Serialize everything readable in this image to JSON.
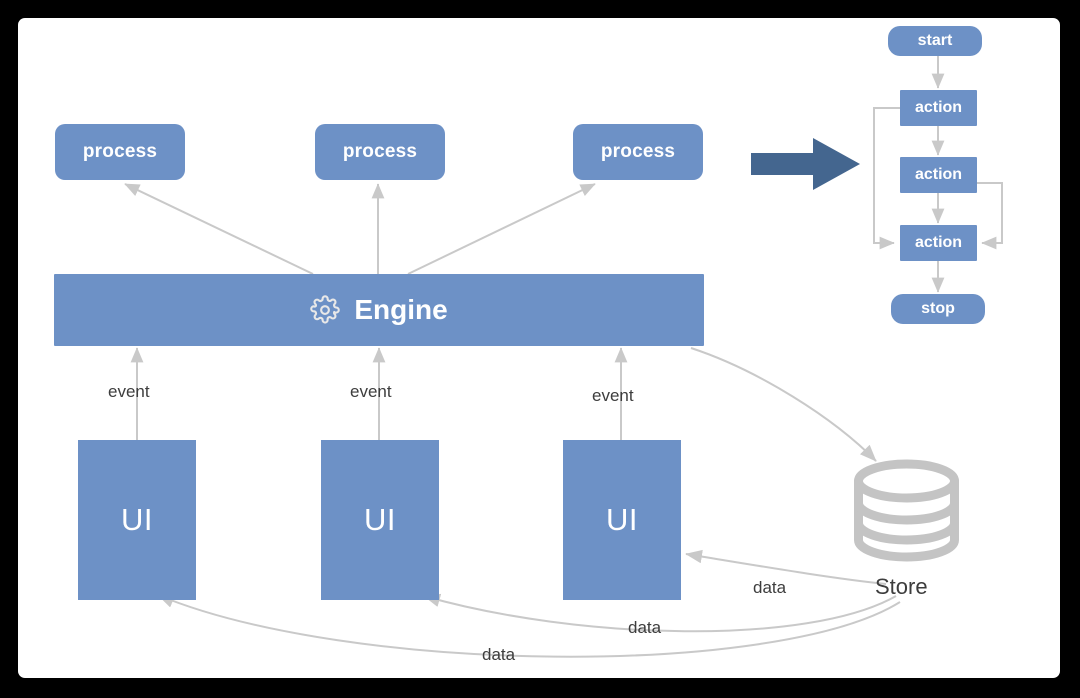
{
  "diagram": {
    "title": "Engine / UI / Store architecture diagram",
    "colors": {
      "node_blue": "#6d91c6",
      "arrow_dark_blue": "#44668f",
      "connector_gray": "#c9c9c9",
      "store_gray": "#c4c4c4",
      "label_text": "#3d3d3d",
      "canvas_background": "#ffffff",
      "frame_background": "#000000"
    },
    "processes": [
      {
        "label": "process"
      },
      {
        "label": "process"
      },
      {
        "label": "process"
      }
    ],
    "engine": {
      "label": "Engine",
      "icon": "gear-icon"
    },
    "uis": [
      {
        "label": "UI",
        "event_label": "event"
      },
      {
        "label": "UI",
        "event_label": "event"
      },
      {
        "label": "UI",
        "event_label": "event"
      }
    ],
    "store": {
      "label": "Store",
      "icon": "database-cylinder-icon"
    },
    "data_labels": [
      {
        "label": "data"
      },
      {
        "label": "data"
      },
      {
        "label": "data"
      }
    ],
    "big_arrow": {
      "icon": "right-arrow-icon"
    },
    "flowchart": {
      "start": {
        "label": "start"
      },
      "actions": [
        {
          "label": "action"
        },
        {
          "label": "action"
        },
        {
          "label": "action"
        }
      ],
      "stop": {
        "label": "stop"
      }
    }
  }
}
